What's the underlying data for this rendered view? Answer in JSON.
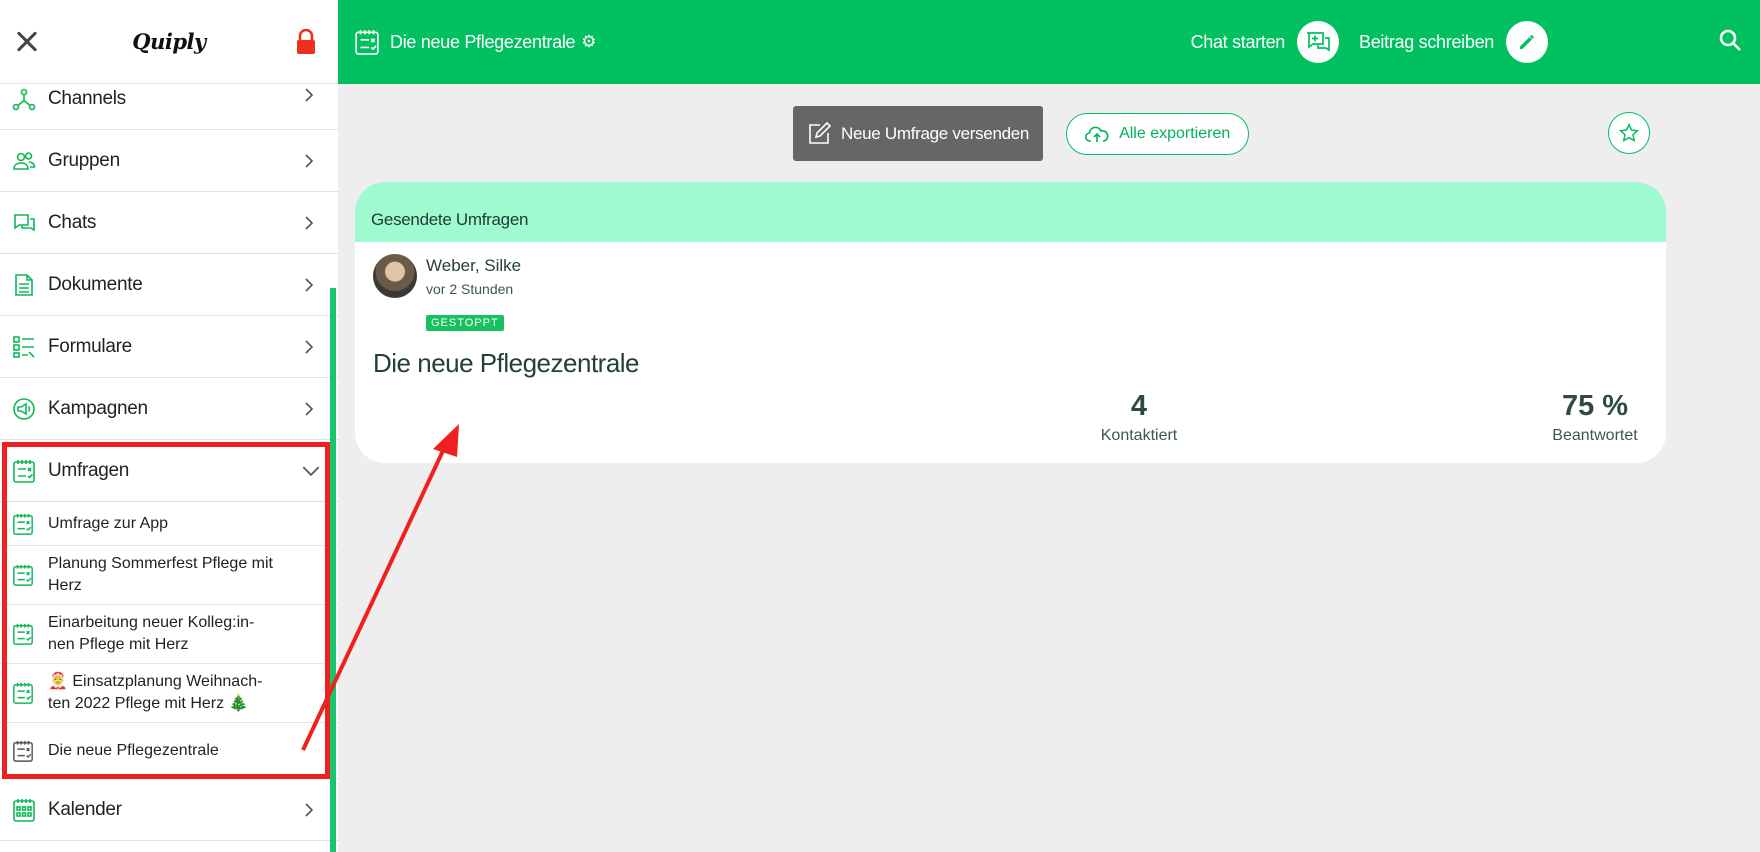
{
  "brand": {
    "logo": "Quiply"
  },
  "sidebar": {
    "items": [
      {
        "label": "Channels"
      },
      {
        "label": "Gruppen"
      },
      {
        "label": "Chats"
      },
      {
        "label": "Dokumente"
      },
      {
        "label": "Formulare"
      },
      {
        "label": "Kampagnen"
      },
      {
        "label": "Umfragen"
      },
      {
        "label": "Kalender"
      }
    ],
    "surveys": [
      {
        "label": "Umfrage zur App"
      },
      {
        "label": "Planung Sommerfest Pflege mit Herz"
      },
      {
        "label": "Einarbeitung neuer Kolleg:in-nen Pflege mit Herz"
      },
      {
        "label": "🤶 Einsatzplanung Weihnach-ten 2022 Pflege mit Herz 🎄"
      },
      {
        "label": "Die neue Pflegezentrale"
      }
    ]
  },
  "header": {
    "title": "Die neue Pflegezentrale",
    "chat_label": "Chat starten",
    "post_label": "Beitrag schreiben"
  },
  "toolbar": {
    "new_survey": "Neue Umfrage versenden",
    "export_all": "Alle exportieren"
  },
  "card": {
    "section_title": "Gesendete Umfragen",
    "author_name": "Weber, Silke",
    "author_time": "vor 2 Stunden",
    "status": "GESTOPPT",
    "poll_title": "Die neue Pflegezentrale",
    "stats": [
      {
        "value": "4",
        "caption": "Kontaktiert"
      },
      {
        "value": "75 %",
        "caption": "Beantwortet"
      }
    ]
  },
  "colors": {
    "brand_green": "#00c060",
    "section_header": "#a0fad0",
    "annotation_red": "#f0201e"
  }
}
